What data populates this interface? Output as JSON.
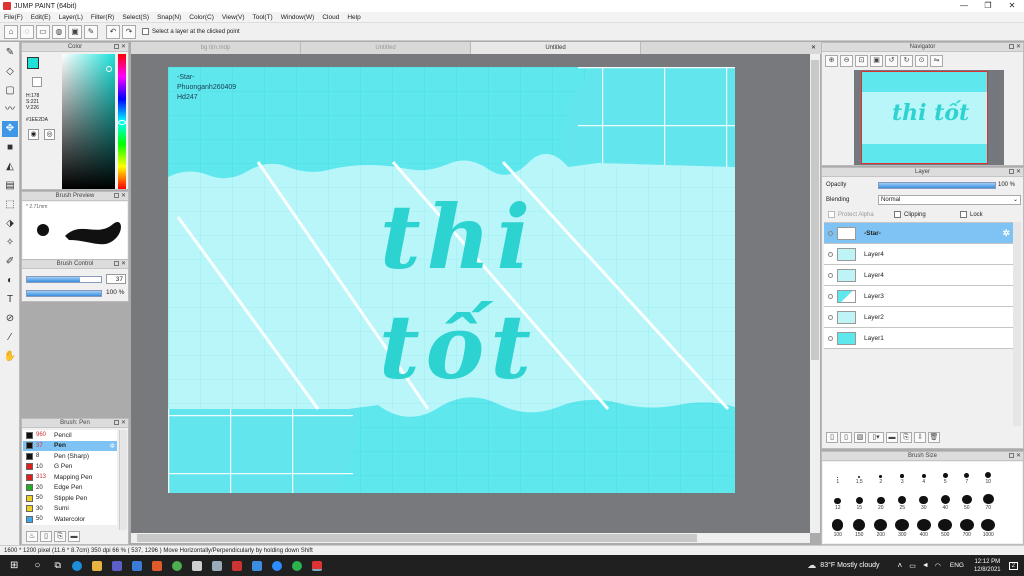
{
  "window": {
    "title": "JUMP PAINT (64bit)",
    "min": "—",
    "max": "❐",
    "close": "✕"
  },
  "menu": [
    "File(F)",
    "Edit(E)",
    "Layer(L)",
    "Filter(R)",
    "Select(S)",
    "Snap(N)",
    "Color(C)",
    "View(V)",
    "Tool(T)",
    "Window(W)",
    "Cloud",
    "Help"
  ],
  "toolbar": {
    "option_label": "Select a layer at the clicked point"
  },
  "tabs": [
    {
      "label": "bg tim.mdp"
    },
    {
      "label": "Untitled"
    },
    {
      "label": "Untitled"
    }
  ],
  "colors": {
    "accent": "#3d96e6",
    "current": "#1EE2DA",
    "canvas_main": "#5ee8ee",
    "canvas_light": "#b8f6f9",
    "lettering": "#2dd3d0"
  },
  "color_panel": {
    "title": "Color",
    "h": "H:178",
    "s": "S:221",
    "v": "V:226",
    "hex": "#1EE2DA"
  },
  "brush_preview": {
    "title": "Brush Preview",
    "size": "2.71mm"
  },
  "brush_control": {
    "title": "Brush Control",
    "size": "37",
    "opacity": "100 %",
    "size_fraction": 0.72,
    "opacity_fraction": 1.0
  },
  "brush_list": {
    "title": "Brush: Pen",
    "items": [
      {
        "size": "960",
        "name": "Pencil",
        "color": "#111111"
      },
      {
        "size": "37",
        "name": "Pen",
        "color": "#111111"
      },
      {
        "size": "8",
        "name": "Pen (Sharp)",
        "color": "#111111"
      },
      {
        "size": "10",
        "name": "G Pen",
        "color": "#e02020"
      },
      {
        "size": "313",
        "name": "Mapping Pen",
        "color": "#e02020"
      },
      {
        "size": "20",
        "name": "Edge Pen",
        "color": "#21b021"
      },
      {
        "size": "50",
        "name": "Stipple Pen",
        "color": "#f0d020"
      },
      {
        "size": "30",
        "name": "Sumi",
        "color": "#f0d020"
      },
      {
        "size": "50",
        "name": "Watercolor",
        "color": "#3aa8e8"
      }
    ]
  },
  "canvas": {
    "watermark": [
      "-Star-",
      "Phuonganh260409",
      "Hd247"
    ],
    "lettering": "thi tốt"
  },
  "navigator": {
    "title": "Navigator"
  },
  "layer_panel": {
    "title": "Layer",
    "opacity_label": "Opacity",
    "opacity_value": "100 %",
    "blending_label": "Blending",
    "blending_value": "Normal",
    "protect_alpha": "Protect Alpha",
    "clipping": "Clipping",
    "lock": "Lock",
    "layers": [
      {
        "name": "-Star-"
      },
      {
        "name": "Layer4"
      },
      {
        "name": "Layer4"
      },
      {
        "name": "Layer3"
      },
      {
        "name": "Layer2"
      },
      {
        "name": "Layer1"
      }
    ]
  },
  "brush_size": {
    "title": "Brush Size",
    "sizes": [
      "1",
      "1.5",
      "2",
      "3",
      "4",
      "5",
      "7",
      "10",
      "12",
      "15",
      "20",
      "25",
      "30",
      "40",
      "50",
      "70",
      "100",
      "150",
      "200",
      "300",
      "400",
      "500",
      "700",
      "1000"
    ]
  },
  "status": {
    "text": "1600 * 1200 pixel  (11.6 * 8.7cm)  350 dpi  66 %  ( 537, 1296 )  Move Horizontally/Perpendicularly by holding down Shift"
  },
  "taskbar": {
    "weather": "83°F  Mostly cloudy",
    "lang": "ENG",
    "time": "12:12 PM",
    "date": "12/8/2021",
    "notif": "2"
  }
}
